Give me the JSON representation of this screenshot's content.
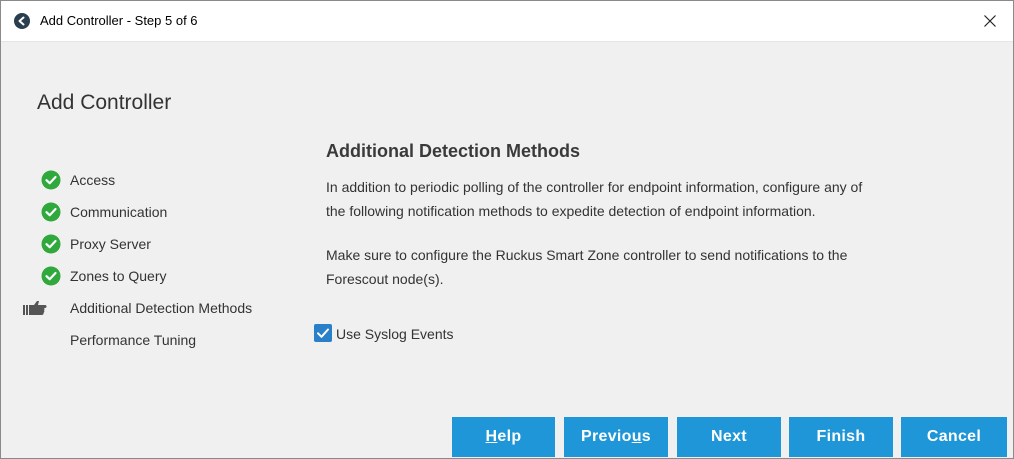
{
  "window": {
    "title": "Add Controller - Step 5 of 6"
  },
  "page": {
    "heading": "Add Controller"
  },
  "steps": [
    {
      "label": "Access",
      "status": "complete",
      "icon": "check-circle-icon"
    },
    {
      "label": "Communication",
      "status": "complete",
      "icon": "check-circle-icon"
    },
    {
      "label": "Proxy Server",
      "status": "complete",
      "icon": "check-circle-icon"
    },
    {
      "label": "Zones to Query",
      "status": "complete",
      "icon": "check-circle-icon"
    },
    {
      "label": "Additional Detection Methods",
      "status": "current",
      "icon": "pointing-hand-icon"
    },
    {
      "label": "Performance Tuning",
      "status": "pending",
      "icon": ""
    }
  ],
  "content": {
    "title": "Additional Detection Methods",
    "para1_line1": "In addition to periodic polling of the controller for endpoint information, configure any of",
    "para1_line2": "the following notification methods to expedite detection of endpoint information.",
    "para2_line1": "Make sure to configure the Ruckus Smart Zone controller to send notifications to the",
    "para2_line2": "Forescout node(s).",
    "syslog_label": "Use Syslog Events",
    "syslog_checked": true
  },
  "buttons": {
    "help_mnemonic": "H",
    "help_rest": "elp",
    "previous_start": "Previo",
    "previous_mnemonic": "u",
    "previous_end": "s",
    "next": "Next",
    "finish": "Finish",
    "cancel": "Cancel"
  },
  "colors": {
    "accent": "#1e96d7",
    "success": "#2fa83c",
    "checkbox": "#2a7fc9"
  }
}
